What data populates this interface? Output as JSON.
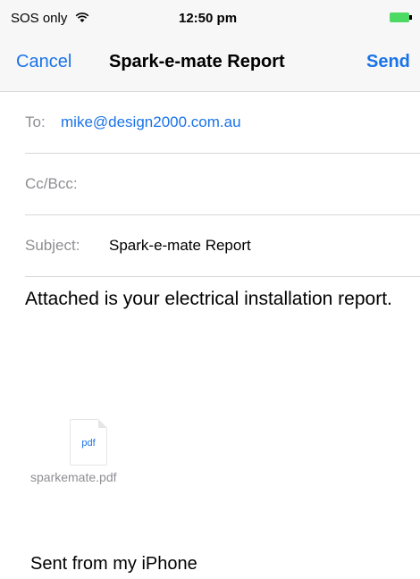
{
  "status": {
    "carrier": "SOS only",
    "time": "12:50 pm"
  },
  "nav": {
    "cancel": "Cancel",
    "title": "Spark-e-mate Report",
    "send": "Send"
  },
  "fields": {
    "to_label": "To:",
    "to_value": "mike@design2000.com.au",
    "ccbcc_label": "Cc/Bcc:",
    "subject_label": "Subject:",
    "subject_value": "Spark-e-mate Report"
  },
  "body": {
    "message": "Attached is your electrical installation report.",
    "attachment_ext": "pdf",
    "attachment_name": "sparkemate.pdf",
    "signature": "Sent from my iPhone"
  },
  "colors": {
    "accent": "#1a73e8",
    "label_gray": "#8e8e93",
    "battery": "#4cd964"
  },
  "icons": {
    "signal": "wifi-icon",
    "battery": "battery-icon",
    "attachment": "pdf-file-icon"
  }
}
